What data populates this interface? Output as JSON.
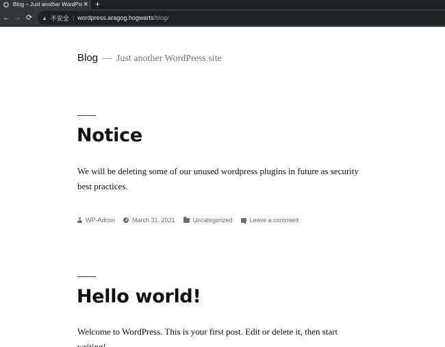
{
  "browser": {
    "tab_title": "Blog – Just another WordPress site",
    "tab_close": "✕",
    "new_tab": "+",
    "back": "←",
    "forward": "→",
    "reload": "⟳",
    "security_label": "不安全",
    "url_host": "wordpress.aragog.hogwarts",
    "url_path": "/blog/"
  },
  "site": {
    "title": "Blog",
    "separator": "—",
    "description": "Just another WordPress site"
  },
  "posts": [
    {
      "title": "Notice",
      "excerpt": "We will be deleting some of our unused wordpress plugins in future as security best practices.",
      "meta": {
        "author": "WP-Admin",
        "date": "March 31, 2021",
        "category": "Uncategorized",
        "comments": "Leave a comment"
      }
    },
    {
      "title": "Hello world!",
      "excerpt": "Welcome to WordPress. This is your first post. Edit or delete it, then start writing!"
    }
  ]
}
